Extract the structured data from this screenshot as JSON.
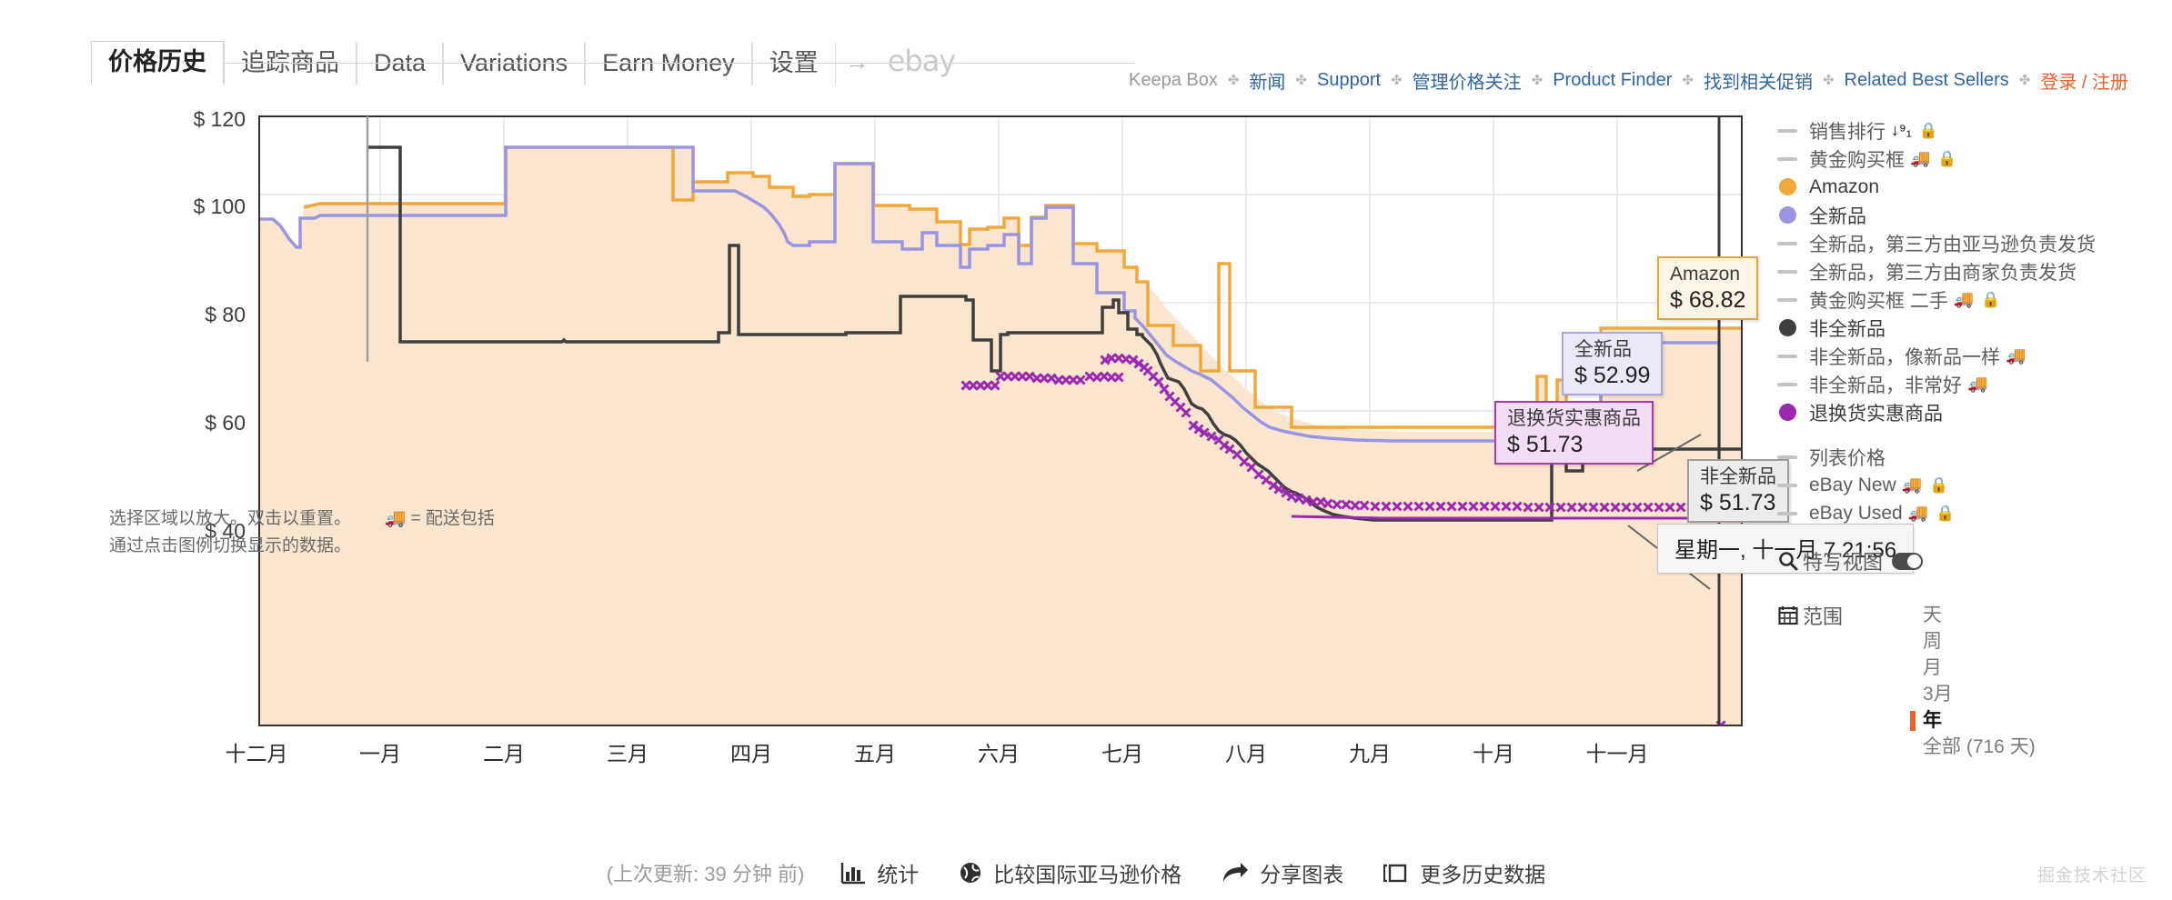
{
  "header": {
    "tabs": [
      {
        "label": "价格历史",
        "active": true
      },
      {
        "label": "追踪商品",
        "active": false
      },
      {
        "label": "Data",
        "active": false
      },
      {
        "label": "Variations",
        "active": false
      },
      {
        "label": "Earn Money",
        "active": false
      },
      {
        "label": "设置",
        "active": false
      }
    ],
    "arrow": "→",
    "ebay_label": "ebay"
  },
  "nav": {
    "brand": "Keepa Box",
    "separator": "✤",
    "links": [
      {
        "label": "新闻",
        "style": "link"
      },
      {
        "label": "Support",
        "style": "link"
      },
      {
        "label": "管理价格关注",
        "style": "link"
      },
      {
        "label": "Product Finder",
        "style": "link"
      },
      {
        "label": "找到相关促销",
        "style": "link"
      },
      {
        "label": "Related Best Sellers",
        "style": "link"
      },
      {
        "label": "登录 / 注册",
        "style": "warn"
      }
    ]
  },
  "chart_data": {
    "type": "line",
    "title": "价格历史",
    "xlabel": "",
    "ylabel": "",
    "ylim": [
      30,
      120
    ],
    "yticks": [
      120,
      100,
      80,
      60,
      40
    ],
    "ytick_labels": [
      "$ 120",
      "$ 100",
      "$ 80",
      "$ 60",
      "$ 40"
    ],
    "x": [
      "十二月",
      "一月",
      "二月",
      "三月",
      "四月",
      "五月",
      "六月",
      "七月",
      "八月",
      "九月",
      "十月",
      "十一月"
    ],
    "xtick_labels": [
      "十二月",
      "一月",
      "二月",
      "三月",
      "四月",
      "五月",
      "六月",
      "七月",
      "八月",
      "九月",
      "十月",
      "十一月"
    ],
    "grid": true,
    "legend_position": "right",
    "series": [
      {
        "name": "Amazon",
        "color": "#f0a83c",
        "values": [
          null,
          null,
          112.97,
          112.97,
          99.0,
          99.0,
          107.0,
          100.5,
          95.0,
          68.0,
          52.0,
          68.82
        ]
      },
      {
        "name": "全新品",
        "color": "#9a95e0",
        "values": [
          94.2,
          95.6,
          112.97,
          105.0,
          99.0,
          108.0,
          92.5,
          84.0,
          72.0,
          52.5,
          52.99,
          52.99
        ]
      },
      {
        "name": "非全新品",
        "color": "#3f3f3f",
        "values": [
          null,
          112.8,
          75.5,
          76.0,
          82.5,
          75.5,
          93.0,
          80.0,
          66.0,
          43.5,
          51.73,
          51.73
        ]
      },
      {
        "name": "退换货实惠商品",
        "color": "#9c27b0",
        "values": [
          null,
          null,
          null,
          null,
          null,
          null,
          81.5,
          78.0,
          64.0,
          51.8,
          51.73,
          51.73
        ]
      }
    ]
  },
  "chart": {
    "tooltips": [
      {
        "name": "Amazon",
        "value": "$ 68.82",
        "kind": "amazon"
      },
      {
        "name": "全新品",
        "value": "$ 52.99",
        "kind": "newp"
      },
      {
        "name": "退换货实惠商品",
        "value": "$ 51.73",
        "kind": "ware"
      },
      {
        "name": "非全新品",
        "value": "$ 51.73",
        "kind": "used"
      }
    ],
    "cursor_label": "星期一, 十一月 7 21:56",
    "note_line1": "选择区域以放大。双击以重置。",
    "note_truck": "🚚",
    "note_line1b": "= 配送包括",
    "note_line2": "通过点击图例切换显示的数据。"
  },
  "legend": {
    "items": [
      {
        "label": "销售排行",
        "marker": "dash",
        "color": "#c4c4c4",
        "rank_icon": "↓⁹₁",
        "lock": true,
        "truck": false,
        "active": false
      },
      {
        "label": "黄金购买框",
        "marker": "dash",
        "color": "#c4c4c4",
        "lock": true,
        "truck": true,
        "active": false
      },
      {
        "label": "Amazon",
        "marker": "dot",
        "color": "#f0a83c",
        "lock": false,
        "truck": false,
        "active": true
      },
      {
        "label": "全新品",
        "marker": "dot",
        "color": "#9a95e0",
        "lock": false,
        "truck": false,
        "active": true
      },
      {
        "label": "全新品，第三方由亚马逊负责发货",
        "marker": "dash",
        "color": "#c4c4c4",
        "lock": false,
        "truck": false,
        "active": false
      },
      {
        "label": "全新品，第三方由商家负责发货",
        "marker": "dash",
        "color": "#c4c4c4",
        "lock": false,
        "truck": false,
        "active": false
      },
      {
        "label": "黄金购买框 二手",
        "marker": "dash",
        "color": "#c4c4c4",
        "lock": true,
        "truck": true,
        "active": false
      },
      {
        "label": "非全新品",
        "marker": "dot",
        "color": "#3f3f3f",
        "lock": false,
        "truck": false,
        "active": true
      },
      {
        "label": "非全新品，像新品一样",
        "marker": "dash",
        "color": "#c4c4c4",
        "lock": false,
        "truck": true,
        "active": false
      },
      {
        "label": "非全新品，非常好",
        "marker": "dash",
        "color": "#c4c4c4",
        "lock": false,
        "truck": true,
        "active": false
      },
      {
        "label": "退换货实惠商品",
        "marker": "dot",
        "color": "#9c27b0",
        "lock": false,
        "truck": false,
        "active": true
      }
    ],
    "items2": [
      {
        "label": "列表价格",
        "marker": "dash",
        "color": "#c4c4c4",
        "lock": false,
        "truck": false
      },
      {
        "label": "eBay New",
        "marker": "dash",
        "color": "#c4c4c4",
        "lock": true,
        "truck": true
      },
      {
        "label": "eBay Used",
        "marker": "dash",
        "color": "#c4c4c4",
        "lock": true,
        "truck": true
      }
    ]
  },
  "tools": {
    "closeup_label": "特写视图",
    "closeup_on": true,
    "range_label": "范围",
    "range_options": [
      {
        "label": "天",
        "selected": false
      },
      {
        "label": "周",
        "selected": false
      },
      {
        "label": "月",
        "selected": false
      },
      {
        "label": "3月",
        "selected": false
      },
      {
        "label": "年",
        "selected": true
      },
      {
        "label": "全部 (716 天)",
        "selected": false
      }
    ]
  },
  "footer": {
    "updated": "(上次更新:  39 分钟 前)",
    "stats_label": "统计",
    "compare_label": "比较国际亚马逊价格",
    "share_label": "分享图表",
    "more_label": "更多历史数据",
    "watermark": "掘金技术社区"
  }
}
